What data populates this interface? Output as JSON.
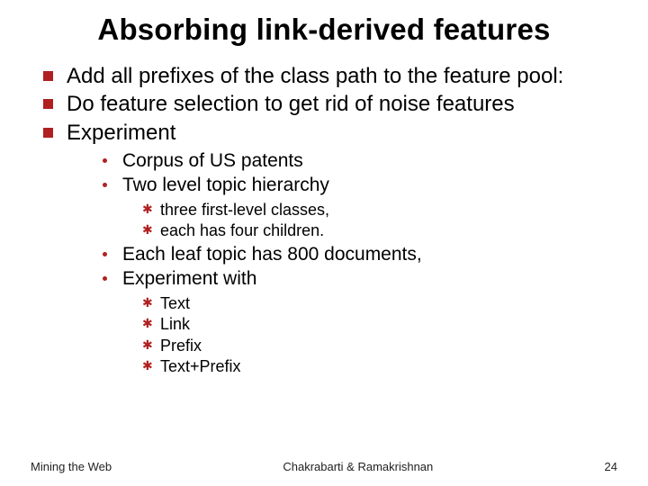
{
  "title": "Absorbing link-derived features",
  "bullets": {
    "items": [
      {
        "text": "Add all prefixes of the class path to the feature pool:"
      },
      {
        "text": "Do feature selection to get rid of noise features"
      },
      {
        "text": "Experiment",
        "children": [
          {
            "text": "Corpus of US patents"
          },
          {
            "text": "Two level topic hierarchy",
            "children": [
              {
                "text": "three first-level classes,"
              },
              {
                "text": "each has four children."
              }
            ]
          },
          {
            "text": "Each leaf topic has 800 documents,"
          },
          {
            "text": "Experiment with",
            "children": [
              {
                "text": "Text"
              },
              {
                "text": "Link"
              },
              {
                "text": "Prefix"
              },
              {
                "text": "Text+Prefix"
              }
            ]
          }
        ]
      }
    ]
  },
  "footer": {
    "left": "Mining the Web",
    "center": "Chakrabarti & Ramakrishnan",
    "right": "24"
  }
}
